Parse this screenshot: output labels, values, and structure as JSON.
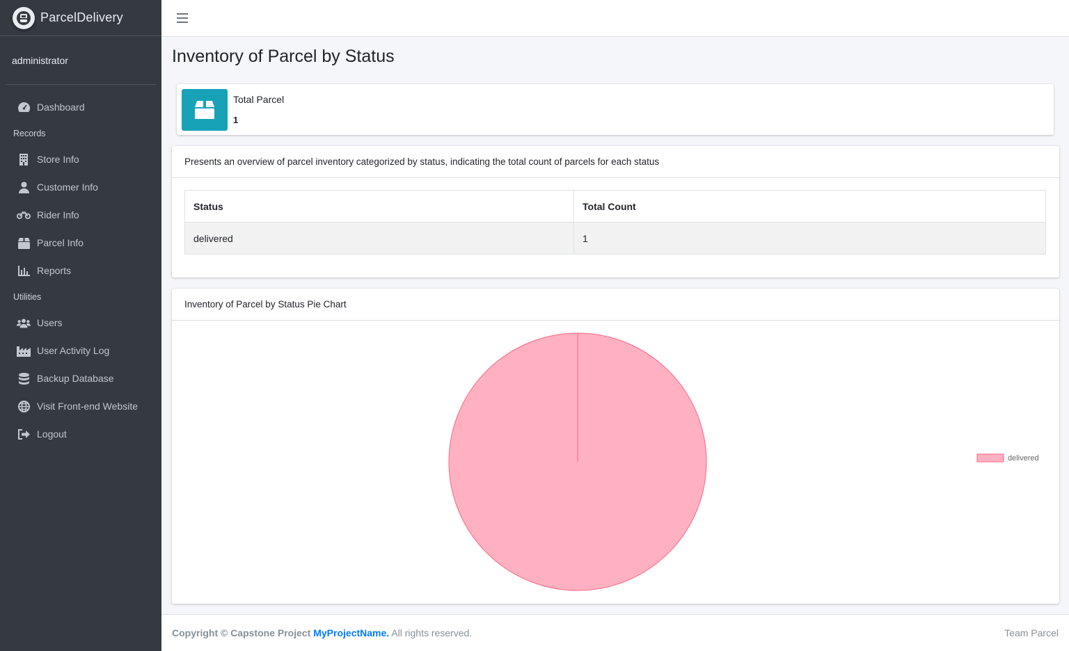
{
  "brand": {
    "name": "ParcelDelivery"
  },
  "user": {
    "name": "administrator"
  },
  "nav": {
    "dashboard": "Dashboard",
    "records_header": "Records",
    "store_info": "Store Info",
    "customer_info": "Customer Info",
    "rider_info": "Rider Info",
    "parcel_info": "Parcel Info",
    "reports": "Reports",
    "utilities_header": "Utilities",
    "users": "Users",
    "user_activity_log": "User Activity Log",
    "backup_database": "Backup Database",
    "visit_frontend": "Visit Front-end Website",
    "logout": "Logout"
  },
  "page": {
    "title": "Inventory of Parcel by Status"
  },
  "info_box": {
    "label": "Total Parcel",
    "value": "1",
    "icon": "box-open-icon",
    "color": "#17a2b8"
  },
  "overview_card": {
    "header": "Presents an overview of parcel inventory categorized by status, indicating the total count of parcels for each status",
    "columns": [
      "Status",
      "Total Count"
    ],
    "rows": [
      {
        "status": "delivered",
        "count": "1"
      }
    ]
  },
  "chart_card": {
    "header": "Inventory of Parcel by Status Pie Chart"
  },
  "chart_data": {
    "type": "pie",
    "categories": [
      "delivered"
    ],
    "values": [
      1
    ],
    "colors": [
      "#ffb1c1"
    ],
    "border_color": "#ff6384",
    "legend": "right"
  },
  "footer": {
    "copyright_prefix": "Copyright © Capstone Project",
    "project_name": "MyProjectName.",
    "rights": "All rights reserved.",
    "team": "Team Parcel"
  }
}
